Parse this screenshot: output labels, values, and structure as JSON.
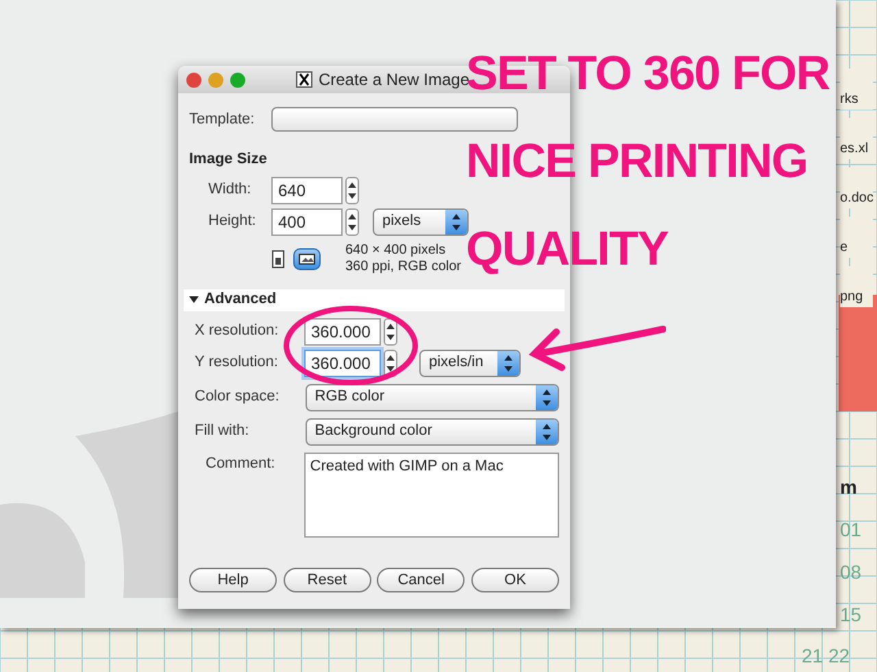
{
  "dialog": {
    "title": "Create a New Image",
    "template": {
      "label": "Template:"
    },
    "image_size": {
      "heading": "Image Size",
      "width": {
        "label": "Width:",
        "value": "640"
      },
      "height": {
        "label": "Height:",
        "value": "400"
      },
      "unit": "pixels",
      "info": [
        "640 × 400 pixels",
        "360 ppi, RGB color"
      ]
    },
    "advanced": {
      "label": "Advanced",
      "expanded": true,
      "x_resolution": {
        "label": "X resolution:",
        "value": "360.000"
      },
      "y_resolution": {
        "label": "Y resolution:",
        "value": "360.000"
      },
      "resolution_unit": "pixels/in",
      "color_space": {
        "label": "Color space:",
        "value": "RGB color"
      },
      "fill": {
        "label": "Fill with:",
        "value": "Background color"
      },
      "comment": {
        "label": "Comment:",
        "value": "Created with GIMP on a Mac"
      }
    },
    "buttons": [
      "Help",
      "Reset",
      "Cancel",
      "OK"
    ]
  },
  "annotation": {
    "lines": [
      "SET TO 360 FOR",
      "NICE PRINTING",
      "QUALITY"
    ]
  },
  "desktop": {
    "file_labels": [
      "rks",
      "es.xl",
      "o.doc",
      "e",
      "png"
    ],
    "calendar": [
      "m",
      "01",
      "08",
      "15",
      "21 22"
    ]
  }
}
